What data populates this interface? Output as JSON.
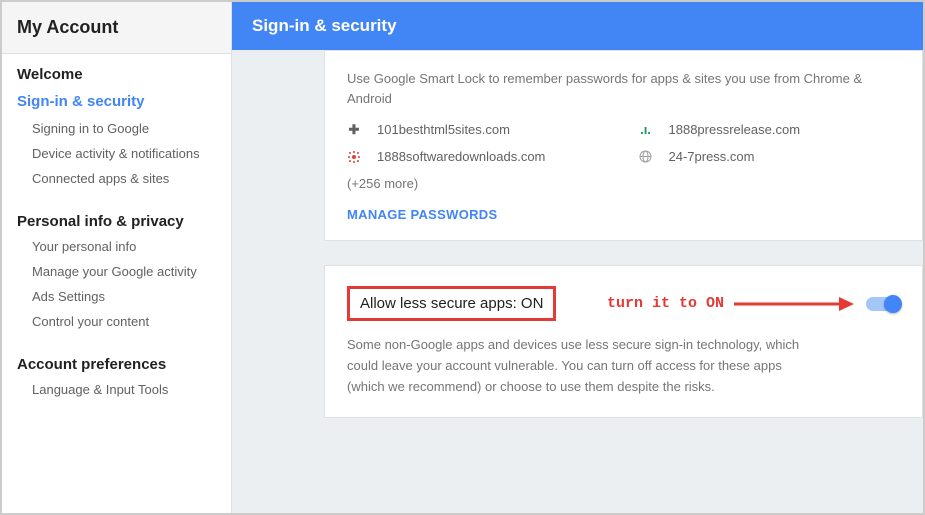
{
  "sidebar": {
    "title": "My Account",
    "welcome": "Welcome",
    "signin_security": "Sign-in & security",
    "signin_items": [
      "Signing in to Google",
      "Device activity & notifications",
      "Connected apps & sites"
    ],
    "personal": "Personal info & privacy",
    "personal_items": [
      "Your personal info",
      "Manage your Google activity",
      "Ads Settings",
      "Control your content"
    ],
    "prefs": "Account preferences",
    "prefs_items": [
      "Language & Input Tools"
    ]
  },
  "header": {
    "title": "Sign-in & security"
  },
  "smartlock": {
    "desc": "Use Google Smart Lock to remember passwords for apps & sites you use from Chrome & Android",
    "sites": [
      {
        "icon": "plus",
        "name": "101besthtml5sites.com"
      },
      {
        "icon": "green",
        "name": "1888pressrelease.com"
      },
      {
        "icon": "red",
        "name": "1888softwaredownloads.com"
      },
      {
        "icon": "globe",
        "name": "24-7press.com"
      }
    ],
    "more": "(+256 more)",
    "manage": "MANAGE PASSWORDS"
  },
  "lsa": {
    "label": "Allow less secure apps: ON",
    "annotation": "turn it to ON",
    "toggle_state": "on",
    "desc": "Some non-Google apps and devices use less secure sign-in technology, which could leave your account vulnerable. You can turn off access for these apps (which we recommend) or choose to use them despite the risks."
  }
}
